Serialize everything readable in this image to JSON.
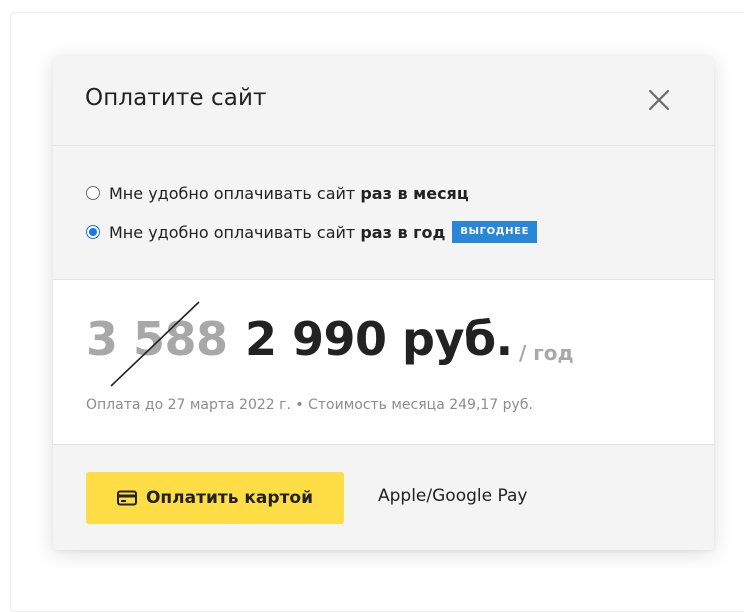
{
  "modal": {
    "title": "Оплатите сайт",
    "close_icon": "close-icon"
  },
  "plan_options": [
    {
      "label_prefix": "Мне удобно оплачивать сайт ",
      "label_bold": "раз в месяц",
      "selected": false
    },
    {
      "label_prefix": "Мне удобно оплачивать сайт ",
      "label_bold": "раз в год",
      "selected": true,
      "badge": "ВЫГОДНЕЕ"
    }
  ],
  "price": {
    "old": "3 588",
    "new": "2 990 руб.",
    "period": "/ год",
    "details": "Оплата до 27 марта 2022 г. • Стоимость месяца 249,17 руб."
  },
  "actions": {
    "pay_card_label": "Оплатить картой",
    "pay_card_icon": "credit-card-icon",
    "alt_pay_label": "Apple/Google Pay"
  },
  "colors": {
    "accent_blue": "#2a86d6",
    "radio_blue": "#1976e6",
    "button_yellow": "#ffde45",
    "muted_gray": "#a8a8a8"
  }
}
